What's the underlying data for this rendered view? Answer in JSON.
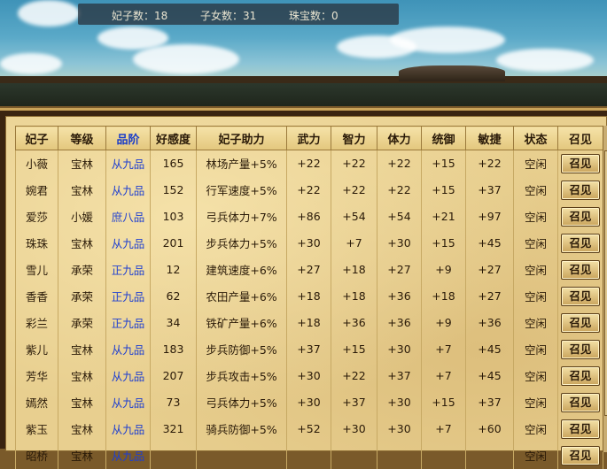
{
  "stats": {
    "concubines": "妃子数：18",
    "children": "子女数：31",
    "jewels": "珠宝数：0"
  },
  "table": {
    "headers": [
      "妃子",
      "等级",
      "品阶",
      "好感度",
      "妃子助力",
      "武力",
      "智力",
      "体力",
      "统御",
      "敏捷",
      "状态",
      "召见"
    ],
    "summon_label": "召见",
    "rows": [
      [
        "小薇",
        "宝林",
        "从九品",
        "165",
        "林场产量+5%",
        "+22",
        "+22",
        "+22",
        "+15",
        "+22",
        "空闲"
      ],
      [
        "婉君",
        "宝林",
        "从九品",
        "152",
        "行军速度+5%",
        "+22",
        "+22",
        "+22",
        "+15",
        "+37",
        "空闲"
      ],
      [
        "爱莎",
        "小媛",
        "庶八品",
        "103",
        "弓兵体力+7%",
        "+86",
        "+54",
        "+54",
        "+21",
        "+97",
        "空闲"
      ],
      [
        "珠珠",
        "宝林",
        "从九品",
        "201",
        "步兵体力+5%",
        "+30",
        "+7",
        "+30",
        "+15",
        "+45",
        "空闲"
      ],
      [
        "雪儿",
        "承荣",
        "正九品",
        "12",
        "建筑速度+6%",
        "+27",
        "+18",
        "+27",
        "+9",
        "+27",
        "空闲"
      ],
      [
        "香香",
        "承荣",
        "正九品",
        "62",
        "农田产量+6%",
        "+18",
        "+18",
        "+36",
        "+18",
        "+27",
        "空闲"
      ],
      [
        "彩兰",
        "承荣",
        "正九品",
        "34",
        "铁矿产量+6%",
        "+18",
        "+36",
        "+36",
        "+9",
        "+36",
        "空闲"
      ],
      [
        "紫儿",
        "宝林",
        "从九品",
        "183",
        "步兵防御+5%",
        "+37",
        "+15",
        "+30",
        "+7",
        "+45",
        "空闲"
      ],
      [
        "芳华",
        "宝林",
        "从九品",
        "207",
        "步兵攻击+5%",
        "+30",
        "+22",
        "+37",
        "+7",
        "+45",
        "空闲"
      ],
      [
        "嫣然",
        "宝林",
        "从九品",
        "73",
        "弓兵体力+5%",
        "+30",
        "+37",
        "+30",
        "+15",
        "+37",
        "空闲"
      ],
      [
        "紫玉",
        "宝林",
        "从九品",
        "321",
        "骑兵防御+5%",
        "+52",
        "+30",
        "+30",
        "+7",
        "+60",
        "空闲"
      ],
      [
        "昭桥",
        "宝林",
        "从九品",
        "",
        "",
        "",
        "",
        "",
        "",
        "",
        "空闲"
      ]
    ]
  }
}
